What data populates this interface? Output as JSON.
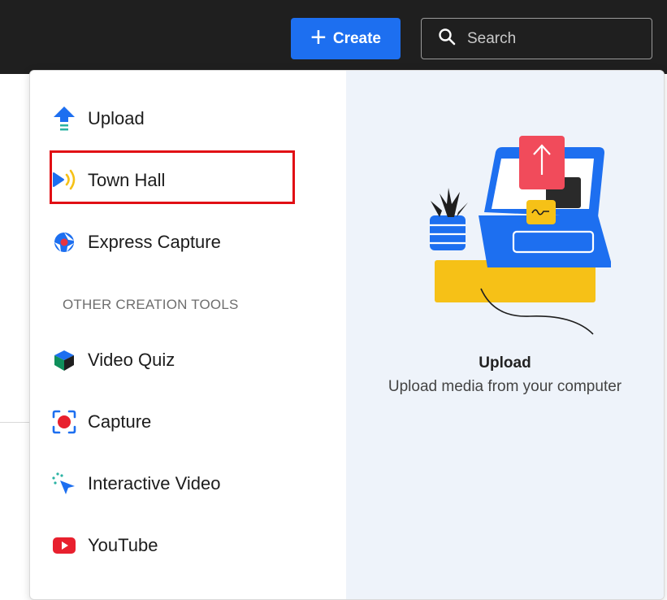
{
  "header": {
    "create_label": "Create",
    "search_placeholder": "Search"
  },
  "menu": {
    "items": [
      {
        "label": "Upload",
        "icon": "upload-arrow-icon"
      },
      {
        "label": "Town Hall",
        "icon": "town-hall-broadcast-icon"
      },
      {
        "label": "Express Capture",
        "icon": "express-capture-icon"
      }
    ],
    "section_label": "OTHER CREATION TOOLS",
    "other_items": [
      {
        "label": "Video Quiz",
        "icon": "video-quiz-cube-icon"
      },
      {
        "label": "Capture",
        "icon": "capture-record-icon"
      },
      {
        "label": "Interactive Video",
        "icon": "interactive-video-cursor-icon"
      },
      {
        "label": "YouTube",
        "icon": "youtube-icon"
      }
    ]
  },
  "preview": {
    "title": "Upload",
    "description": "Upload media from your computer"
  },
  "colors": {
    "topbar": "#1f1f1f",
    "accent_blue": "#1d6ff0",
    "highlight_red": "#e10f14",
    "preview_bg": "#eef3fa"
  }
}
